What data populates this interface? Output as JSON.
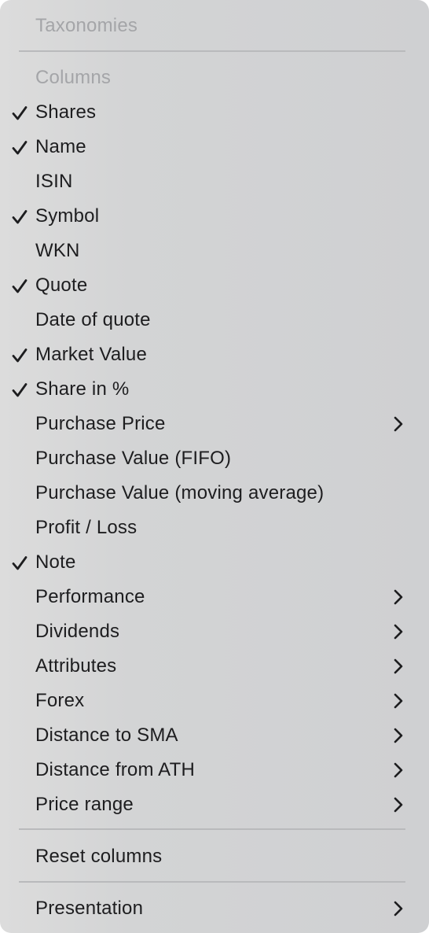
{
  "menu": {
    "taxonomies_header": "Taxonomies",
    "columns_header": "Columns",
    "items": [
      {
        "label": "Shares",
        "checked": true,
        "submenu": false
      },
      {
        "label": "Name",
        "checked": true,
        "submenu": false
      },
      {
        "label": "ISIN",
        "checked": false,
        "submenu": false
      },
      {
        "label": "Symbol",
        "checked": true,
        "submenu": false
      },
      {
        "label": "WKN",
        "checked": false,
        "submenu": false
      },
      {
        "label": "Quote",
        "checked": true,
        "submenu": false
      },
      {
        "label": "Date of quote",
        "checked": false,
        "submenu": false
      },
      {
        "label": "Market Value",
        "checked": true,
        "submenu": false
      },
      {
        "label": "Share in %",
        "checked": true,
        "submenu": false
      },
      {
        "label": "Purchase Price",
        "checked": false,
        "submenu": true
      },
      {
        "label": "Purchase Value (FIFO)",
        "checked": false,
        "submenu": false
      },
      {
        "label": "Purchase Value (moving average)",
        "checked": false,
        "submenu": false
      },
      {
        "label": "Profit / Loss",
        "checked": false,
        "submenu": false
      },
      {
        "label": "Note",
        "checked": true,
        "submenu": false
      },
      {
        "label": "Performance",
        "checked": false,
        "submenu": true
      },
      {
        "label": "Dividends",
        "checked": false,
        "submenu": true
      },
      {
        "label": "Attributes",
        "checked": false,
        "submenu": true
      },
      {
        "label": "Forex",
        "checked": false,
        "submenu": true
      },
      {
        "label": "Distance to SMA",
        "checked": false,
        "submenu": true
      },
      {
        "label": "Distance from ATH",
        "checked": false,
        "submenu": true
      },
      {
        "label": "Price range",
        "checked": false,
        "submenu": true
      }
    ],
    "reset_columns": "Reset columns",
    "presentation": "Presentation"
  }
}
